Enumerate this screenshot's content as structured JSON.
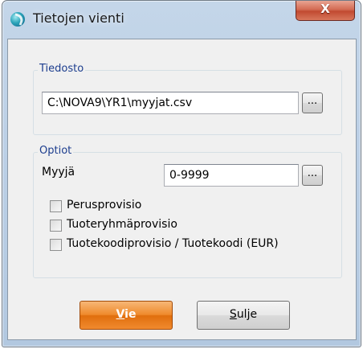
{
  "window": {
    "title": "Tietojen vienti",
    "close_label": "X"
  },
  "file_group": {
    "legend": "Tiedosto",
    "path_value": "C:\\NOVA9\\YR1\\myyjat.csv",
    "browse_label": "..."
  },
  "options_group": {
    "legend": "Optiot",
    "seller_label": "Myyjä",
    "seller_value": "0-9999",
    "browse_label": "...",
    "checkboxes": [
      {
        "label": "Perusprovisio",
        "checked": false
      },
      {
        "label": "Tuoteryhmäprovisio",
        "checked": false
      },
      {
        "label": "Tuotekoodiprovisio / Tuotekoodi (EUR)",
        "checked": false
      }
    ]
  },
  "buttons": {
    "export": {
      "mnemonic": "V",
      "rest": "ie"
    },
    "close": {
      "mnemonic": "S",
      "rest": "ulje"
    }
  },
  "colors": {
    "legend_text": "#1c3d8e",
    "primary_button": "#ef8a2c",
    "close_button": "#c14a31"
  }
}
